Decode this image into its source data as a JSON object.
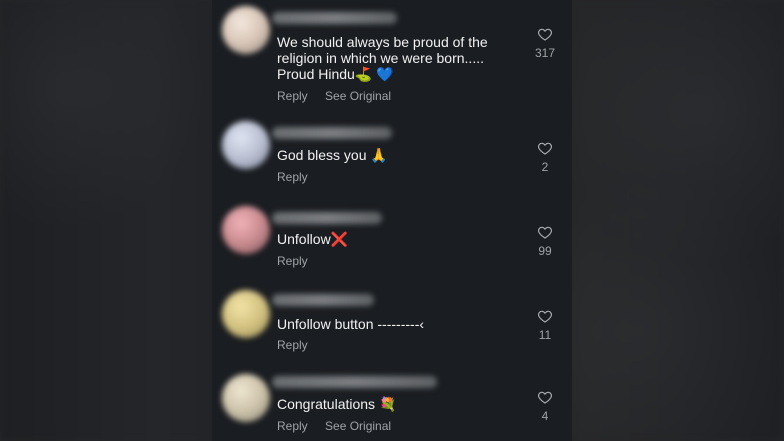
{
  "comments": [
    {
      "text": "We should always be proud of the religion in which we were born..... Proud Hindu⛳ 💙",
      "actions": {
        "reply": "Reply",
        "see_original": "See Original"
      },
      "likes": "317",
      "avatar_color": "#d7c5b6"
    },
    {
      "text": "God bless you 🙏",
      "actions": {
        "reply": "Reply"
      },
      "likes": "2",
      "avatar_color": "#b9bfd1"
    },
    {
      "text": "Unfollow❌",
      "actions": {
        "reply": "Reply"
      },
      "likes": "99",
      "avatar_color": "#c78a8e"
    },
    {
      "text": "Unfollow button ---------‹",
      "actions": {
        "reply": "Reply"
      },
      "likes": "11",
      "avatar_color": "#d2c180"
    },
    {
      "text": "Congratulations 💐",
      "actions": {
        "reply": "Reply",
        "see_original": "See Original"
      },
      "likes": "4",
      "avatar_color": "#ccc2aa"
    }
  ],
  "icons": {
    "like": "heart-outline-icon"
  }
}
